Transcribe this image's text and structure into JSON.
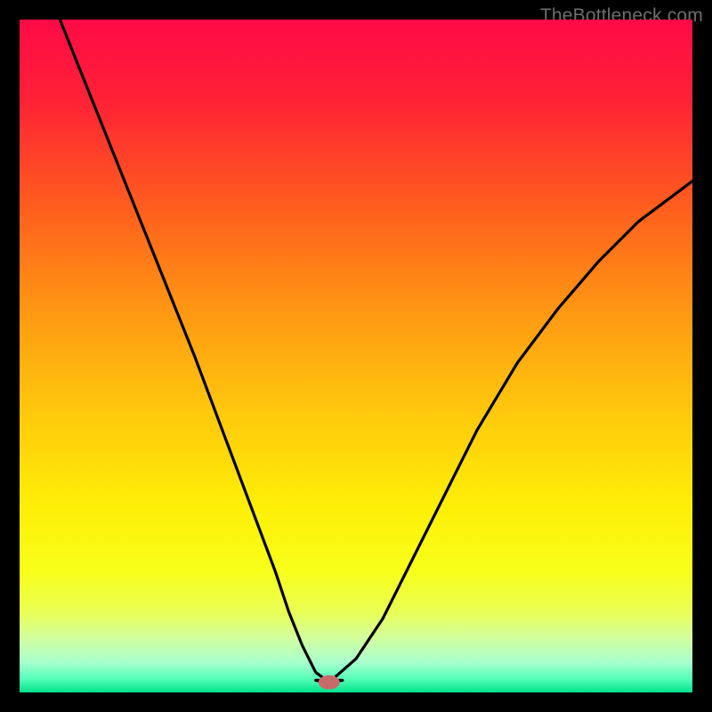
{
  "watermark": "TheBottleneck.com",
  "chart_data": {
    "type": "line",
    "title": "",
    "xlabel": "",
    "ylabel": "",
    "xlim": [
      0,
      100
    ],
    "ylim": [
      0,
      100
    ],
    "marker": {
      "x": 46,
      "y": 1.5,
      "color": "#c96a6a"
    },
    "curve_left": {
      "x": [
        6,
        10,
        14,
        18,
        22,
        26,
        29,
        32,
        35,
        38,
        40,
        42,
        44,
        46
      ],
      "y": [
        100,
        90,
        80,
        70,
        60,
        50,
        42,
        34,
        26,
        18,
        12,
        7,
        3,
        1.5
      ]
    },
    "plateau": {
      "x": [
        44,
        48
      ],
      "y": [
        1.8,
        1.8
      ]
    },
    "curve_right": {
      "x": [
        46,
        50,
        54,
        58,
        63,
        68,
        74,
        80,
        86,
        92,
        100
      ],
      "y": [
        1.5,
        5,
        11,
        19,
        29,
        39,
        49,
        57,
        64,
        70,
        76
      ]
    }
  }
}
